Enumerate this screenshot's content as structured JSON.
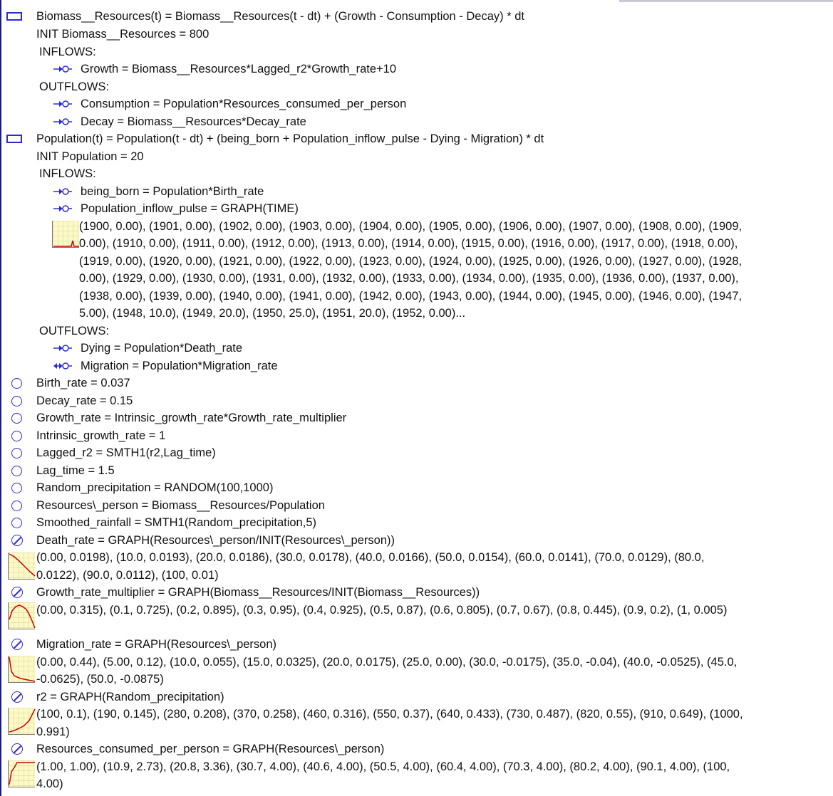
{
  "colors": {
    "icon_blue": "#2b2bd0",
    "graph_curve": "#cc0000",
    "graph_bg": "#fdfac8"
  },
  "equations": {
    "stock1": "Biomass__Resources(t) = Biomass__Resources(t - dt) + (Growth - Consumption - Decay) * dt",
    "stock1_init": "INIT Biomass__Resources = 800",
    "inflows_label": "INFLOWS:",
    "outflows_label": "OUTFLOWS:",
    "growth": "Growth = Biomass__Resources*Lagged_r2*Growth_rate+10",
    "consumption": "Consumption = Population*Resources_consumed_per_person",
    "decay": "Decay = Biomass__Resources*Decay_rate",
    "stock2": "Population(t) = Population(t - dt) + (being_born + Population_inflow_pulse - Dying - Migration) * dt",
    "stock2_init": "INIT Population = 20",
    "being_born": "being_born = Population*Birth_rate",
    "pulse": "Population_inflow_pulse = GRAPH(TIME)",
    "pulse_data": [
      "(1900, 0.00), (1901, 0.00), (1902, 0.00), (1903, 0.00), (1904, 0.00), (1905, 0.00), (1906, 0.00), (1907, 0.00), (1908, 0.00), (1909,",
      "0.00), (1910, 0.00), (1911, 0.00), (1912, 0.00), (1913, 0.00), (1914, 0.00), (1915, 0.00), (1916, 0.00), (1917, 0.00), (1918, 0.00),",
      "(1919, 0.00), (1920, 0.00), (1921, 0.00), (1922, 0.00), (1923, 0.00), (1924, 0.00), (1925, 0.00), (1926, 0.00), (1927, 0.00), (1928,",
      "0.00), (1929, 0.00), (1930, 0.00), (1931, 0.00), (1932, 0.00), (1933, 0.00), (1934, 0.00), (1935, 0.00), (1936, 0.00), (1937, 0.00),",
      "(1938, 0.00), (1939, 0.00), (1940, 0.00), (1941, 0.00), (1942, 0.00), (1943, 0.00), (1944, 0.00), (1945, 0.00), (1946, 0.00), (1947,",
      "5.00), (1948, 10.0), (1949, 20.0), (1950, 25.0), (1951, 20.0), (1952, 0.00)..."
    ],
    "dying": "Dying = Population*Death_rate",
    "migration": "Migration = Population*Migration_rate",
    "birth_rate": "Birth_rate = 0.037",
    "decay_rate": "Decay_rate = 0.15",
    "growth_rate": "Growth_rate = Intrinsic_growth_rate*Growth_rate_multiplier",
    "intrinsic": "Intrinsic_growth_rate = 1",
    "lagged_r2": "Lagged_r2 = SMTH1(r2,Lag_time)",
    "lag_time": "Lag_time = 1.5",
    "random_precip": "Random_precipitation = RANDOM(100,1000)",
    "resources_person": "Resources\\_person = Biomass__Resources/Population",
    "smoothed": "Smoothed_rainfall = SMTH1(Random_precipitation,5)",
    "death_rate": "Death_rate = GRAPH(Resources\\_person/INIT(Resources\\_person))",
    "death_rate_data": [
      "(0.00, 0.0198), (10.0, 0.0193), (20.0, 0.0186), (30.0, 0.0178), (40.0, 0.0166), (50.0, 0.0154), (60.0, 0.0141), (70.0, 0.0129), (80.0,",
      "0.0122), (90.0, 0.0112), (100, 0.01)"
    ],
    "grm": "Growth_rate_multiplier = GRAPH(Biomass__Resources/INIT(Biomass__Resources))",
    "grm_data": [
      "(0.00, 0.315), (0.1, 0.725), (0.2, 0.895), (0.3, 0.95), (0.4, 0.925), (0.5, 0.87), (0.6, 0.805), (0.7, 0.67), (0.8, 0.445), (0.9, 0.2), (1, 0.005)"
    ],
    "migration_rate": "Migration_rate = GRAPH(Resources\\_person)",
    "migration_rate_data": [
      "(0.00, 0.44), (5.00, 0.12), (10.0, 0.055), (15.0, 0.0325), (20.0, 0.0175), (25.0, 0.00), (30.0, -0.0175), (35.0, -0.04), (40.0, -0.0525), (45.0,",
      "-0.0625), (50.0, -0.0875)"
    ],
    "r2": "r2 = GRAPH(Random_precipitation)",
    "r2_data": [
      "(100, 0.1), (190, 0.145), (280, 0.208), (370, 0.258), (460, 0.316), (550, 0.37), (640, 0.433), (730, 0.487), (820, 0.55), (910, 0.649), (1000,",
      "0.991)"
    ],
    "rcpp": "Resources_consumed_per_person = GRAPH(Resources\\_person)",
    "rcpp_data": [
      "(1.00, 1.00), (10.9, 2.73), (20.8, 3.36), (30.7, 4.00), (40.6, 4.00), (50.5, 4.00), (60.4, 4.00), (70.3, 4.00), (80.2, 4.00), (90.1, 4.00), (100,",
      "4.00)"
    ]
  }
}
